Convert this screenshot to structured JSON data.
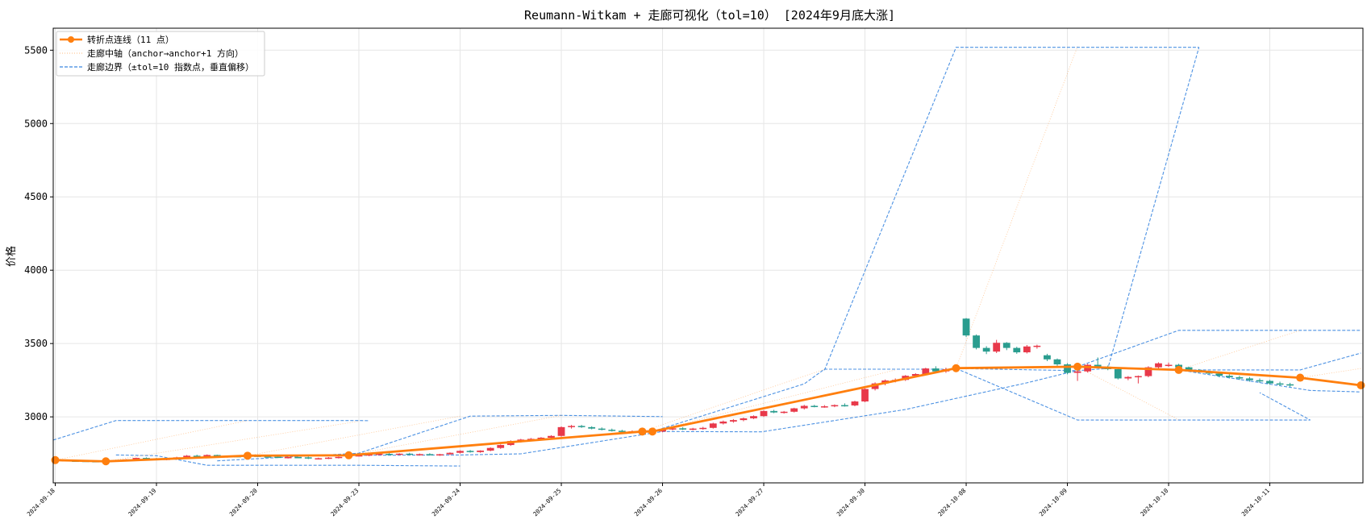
{
  "chart_data": {
    "type": "candlestick",
    "title": "Reumann-Witkam + 走廊可视化（tol=10）  [2024年9月底大涨]",
    "ylabel": "价格",
    "xlabel": "",
    "ylim": [
      2550,
      5650
    ],
    "yticks": [
      3000,
      3500,
      4000,
      4500,
      5000,
      5500
    ],
    "x_range": [
      -0.2,
      129.2
    ],
    "grid": true,
    "legend_position": "top-left",
    "xtick_labels": [
      {
        "i": 0,
        "label": "2024-09-18"
      },
      {
        "i": 10,
        "label": "2024-09-19"
      },
      {
        "i": 20,
        "label": "2024-09-20"
      },
      {
        "i": 30,
        "label": "2024-09-23"
      },
      {
        "i": 40,
        "label": "2024-09-24"
      },
      {
        "i": 50,
        "label": "2024-09-25"
      },
      {
        "i": 60,
        "label": "2024-09-26"
      },
      {
        "i": 70,
        "label": "2024-09-27"
      },
      {
        "i": 80,
        "label": "2024-09-30"
      },
      {
        "i": 90,
        "label": "2024-10-08"
      },
      {
        "i": 100,
        "label": "2024-10-09"
      },
      {
        "i": 110,
        "label": "2024-10-10"
      },
      {
        "i": 120,
        "label": "2024-10-11"
      }
    ],
    "colors": {
      "up": "#e8394a",
      "down": "#2a9d8f",
      "polyline": "#ff7f0e",
      "axis": "#ff7f0e",
      "band": "#3a86e0"
    },
    "legend": [
      {
        "label": "转折点连线（11 点）",
        "style": "polyline"
      },
      {
        "label": "走廊中轴（anchor→anchor+1 方向）",
        "style": "axis"
      },
      {
        "label": "走廊边界（±tol=10 指数点，垂直偏移）",
        "style": "band"
      }
    ],
    "candles_ohlc": [
      [
        2703,
        2708,
        2699,
        2704
      ],
      [
        2704,
        2709,
        2699,
        2702
      ],
      [
        2701,
        2706,
        2696,
        2700
      ],
      [
        2700,
        2705,
        2694,
        2698
      ],
      [
        2698,
        2703,
        2693,
        2697
      ],
      [
        2697,
        2704,
        2692,
        2699
      ],
      [
        2699,
        2706,
        2694,
        2702
      ],
      [
        2702,
        2712,
        2697,
        2710
      ],
      [
        2710,
        2722,
        2705,
        2720
      ],
      [
        2720,
        2724,
        2708,
        2712
      ],
      [
        2712,
        2720,
        2704,
        2710
      ],
      [
        2710,
        2718,
        2704,
        2714
      ],
      [
        2714,
        2728,
        2710,
        2724
      ],
      [
        2724,
        2740,
        2718,
        2735
      ],
      [
        2735,
        2742,
        2722,
        2728
      ],
      [
        2728,
        2744,
        2724,
        2740
      ],
      [
        2740,
        2742,
        2726,
        2728
      ],
      [
        2728,
        2736,
        2722,
        2732
      ],
      [
        2732,
        2738,
        2726,
        2730
      ],
      [
        2730,
        2738,
        2724,
        2735
      ],
      [
        2735,
        2740,
        2726,
        2730
      ],
      [
        2730,
        2736,
        2724,
        2728
      ],
      [
        2728,
        2733,
        2720,
        2722
      ],
      [
        2722,
        2730,
        2716,
        2726
      ],
      [
        2726,
        2732,
        2720,
        2724
      ],
      [
        2724,
        2730,
        2712,
        2716
      ],
      [
        2716,
        2722,
        2710,
        2718
      ],
      [
        2718,
        2726,
        2712,
        2722
      ],
      [
        2722,
        2730,
        2716,
        2727
      ],
      [
        2727,
        2738,
        2722,
        2735
      ],
      [
        2735,
        2742,
        2730,
        2738
      ],
      [
        2738,
        2748,
        2732,
        2744
      ],
      [
        2744,
        2752,
        2738,
        2748
      ],
      [
        2748,
        2756,
        2740,
        2745
      ],
      [
        2745,
        2752,
        2738,
        2749
      ],
      [
        2749,
        2755,
        2740,
        2742
      ],
      [
        2742,
        2750,
        2736,
        2746
      ],
      [
        2746,
        2752,
        2738,
        2740
      ],
      [
        2740,
        2748,
        2734,
        2745
      ],
      [
        2745,
        2758,
        2740,
        2755
      ],
      [
        2755,
        2772,
        2750,
        2768
      ],
      [
        2768,
        2774,
        2756,
        2760
      ],
      [
        2760,
        2772,
        2755,
        2770
      ],
      [
        2770,
        2792,
        2765,
        2788
      ],
      [
        2788,
        2812,
        2782,
        2808
      ],
      [
        2808,
        2840,
        2802,
        2835
      ],
      [
        2835,
        2850,
        2825,
        2845
      ],
      [
        2845,
        2856,
        2836,
        2850
      ],
      [
        2850,
        2862,
        2844,
        2858
      ],
      [
        2858,
        2875,
        2850,
        2870
      ],
      [
        2870,
        2935,
        2865,
        2930
      ],
      [
        2930,
        2945,
        2920,
        2938
      ],
      [
        2938,
        2945,
        2925,
        2930
      ],
      [
        2930,
        2936,
        2915,
        2920
      ],
      [
        2920,
        2928,
        2908,
        2912
      ],
      [
        2912,
        2920,
        2900,
        2905
      ],
      [
        2905,
        2912,
        2895,
        2900
      ],
      [
        2900,
        2908,
        2890,
        2902
      ],
      [
        2902,
        2908,
        2892,
        2896
      ],
      [
        2896,
        2905,
        2888,
        2900
      ],
      [
        2900,
        2920,
        2895,
        2915
      ],
      [
        2915,
        2928,
        2908,
        2922
      ],
      [
        2922,
        2930,
        2910,
        2914
      ],
      [
        2914,
        2925,
        2908,
        2920
      ],
      [
        2920,
        2932,
        2912,
        2925
      ],
      [
        2925,
        2960,
        2920,
        2955
      ],
      [
        2955,
        2975,
        2948,
        2968
      ],
      [
        2968,
        2985,
        2960,
        2978
      ],
      [
        2978,
        2995,
        2970,
        2990
      ],
      [
        2990,
        3010,
        2985,
        3005
      ],
      [
        3005,
        3045,
        3000,
        3040
      ],
      [
        3040,
        3048,
        3025,
        3030
      ],
      [
        3030,
        3040,
        3022,
        3035
      ],
      [
        3035,
        3062,
        3030,
        3058
      ],
      [
        3058,
        3082,
        3050,
        3075
      ],
      [
        3075,
        3082,
        3065,
        3070
      ],
      [
        3070,
        3080,
        3062,
        3072
      ],
      [
        3072,
        3085,
        3066,
        3080
      ],
      [
        3080,
        3092,
        3070,
        3078
      ],
      [
        3078,
        3110,
        3072,
        3105
      ],
      [
        3105,
        3195,
        3100,
        3190
      ],
      [
        3190,
        3235,
        3180,
        3228
      ],
      [
        3228,
        3255,
        3215,
        3248
      ],
      [
        3248,
        3262,
        3235,
        3252
      ],
      [
        3252,
        3285,
        3245,
        3280
      ],
      [
        3280,
        3298,
        3270,
        3292
      ],
      [
        3292,
        3335,
        3285,
        3330
      ],
      [
        3330,
        3345,
        3300,
        3310
      ],
      [
        3310,
        3335,
        3300,
        3325
      ],
      [
        3325,
        3348,
        3312,
        3336
      ],
      [
        3670,
        3674,
        3545,
        3555
      ],
      [
        3555,
        3562,
        3460,
        3470
      ],
      [
        3470,
        3482,
        3428,
        3445
      ],
      [
        3445,
        3525,
        3435,
        3505
      ],
      [
        3505,
        3510,
        3455,
        3470
      ],
      [
        3470,
        3478,
        3430,
        3440
      ],
      [
        3440,
        3490,
        3432,
        3480
      ],
      [
        3480,
        3492,
        3465,
        3485
      ],
      [
        3420,
        3430,
        3380,
        3392
      ],
      [
        3392,
        3398,
        3348,
        3358
      ],
      [
        3358,
        3366,
        3290,
        3300
      ],
      [
        3300,
        3315,
        3245,
        3310
      ],
      [
        3310,
        3362,
        3302,
        3355
      ],
      [
        3355,
        3405,
        3345,
        3342
      ],
      [
        3342,
        3350,
        3318,
        3325
      ],
      [
        3325,
        3330,
        3255,
        3262
      ],
      [
        3262,
        3278,
        3250,
        3272
      ],
      [
        3272,
        3282,
        3228,
        3278
      ],
      [
        3278,
        3345,
        3270,
        3338
      ],
      [
        3338,
        3372,
        3330,
        3365
      ],
      [
        3350,
        3370,
        3340,
        3355
      ],
      [
        3355,
        3362,
        3330,
        3338
      ],
      [
        3338,
        3342,
        3315,
        3320
      ],
      [
        3320,
        3326,
        3300,
        3305
      ],
      [
        3305,
        3312,
        3290,
        3295
      ],
      [
        3295,
        3302,
        3270,
        3280
      ],
      [
        3280,
        3290,
        3262,
        3270
      ],
      [
        3270,
        3280,
        3252,
        3262
      ],
      [
        3262,
        3272,
        3240,
        3250
      ],
      [
        3250,
        3262,
        3232,
        3245
      ],
      [
        3245,
        3252,
        3220,
        3228
      ],
      [
        3228,
        3240,
        3210,
        3222
      ],
      [
        3222,
        3232,
        3205,
        3215
      ]
    ],
    "turning_points": [
      {
        "x": 0,
        "y": 2705
      },
      {
        "x": 5,
        "y": 2697
      },
      {
        "x": 19,
        "y": 2735
      },
      {
        "x": 29,
        "y": 2738
      },
      {
        "x": 58,
        "y": 2900
      },
      {
        "x": 59,
        "y": 2900
      },
      {
        "x": 89,
        "y": 3332
      },
      {
        "x": 101,
        "y": 3342
      },
      {
        "x": 111,
        "y": 3320
      },
      {
        "x": 123,
        "y": 3267
      },
      {
        "x": 129,
        "y": 3215
      }
    ],
    "corridor_axes": [
      [
        [
          0,
          2705
        ],
        [
          19,
          2975
        ]
      ],
      [
        [
          5,
          2697
        ],
        [
          30,
          2970
        ]
      ],
      [
        [
          19,
          2735
        ],
        [
          40,
          3005
        ]
      ],
      [
        [
          29,
          2738
        ],
        [
          50,
          3010
        ]
      ],
      [
        [
          58,
          2900
        ],
        [
          76,
          3325
        ]
      ],
      [
        [
          59,
          2900
        ],
        [
          83,
          3320
        ]
      ],
      [
        [
          89,
          3332
        ],
        [
          101,
          5525
        ]
      ],
      [
        [
          101,
          3342
        ],
        [
          111,
          2980
        ]
      ],
      [
        [
          111,
          3320
        ],
        [
          123,
          3590
        ]
      ],
      [
        [
          123,
          3267
        ],
        [
          129,
          3330
        ]
      ]
    ],
    "corridor_bands": [
      {
        "upper": [
          [
            -0.2,
            2842
          ],
          [
            6,
            2975
          ],
          [
            19,
            2975
          ],
          [
            30,
            2975
          ],
          [
            31,
            2974
          ]
        ],
        "lower": [
          [
            6,
            2740
          ],
          [
            10,
            2735
          ],
          [
            15,
            2670
          ],
          [
            30,
            2670
          ],
          [
            40,
            2665
          ]
        ]
      },
      {
        "upper": [
          [
            16,
            2700
          ],
          [
            30,
            2752
          ],
          [
            41,
            3005
          ],
          [
            50,
            3010
          ],
          [
            60,
            3002
          ]
        ],
        "lower": [
          [
            30,
            2738
          ],
          [
            40,
            2740
          ],
          [
            46,
            2748
          ],
          [
            60,
            2900
          ],
          [
            70,
            2898
          ]
        ]
      },
      {
        "upper": [
          [
            59,
            2900
          ],
          [
            74,
            3225
          ],
          [
            76,
            3325
          ],
          [
            89,
            3325
          ]
        ],
        "lower": [
          [
            70,
            2900
          ],
          [
            84,
            3050
          ],
          [
            96,
            3232
          ],
          [
            100,
            3300
          ],
          [
            101,
            3315
          ]
        ]
      },
      {
        "upper": [
          [
            76,
            3318
          ],
          [
            89,
            5520
          ],
          [
            101,
            5520
          ],
          [
            113,
            5520
          ]
        ],
        "lower": [
          [
            89,
            3330
          ],
          [
            101,
            3315
          ],
          [
            104,
            3330
          ],
          [
            113,
            5520
          ]
        ]
      },
      {
        "upper": [
          [
            101,
            3342
          ],
          [
            111,
            3590
          ],
          [
            129,
            3590
          ]
        ],
        "lower": [
          [
            89,
            3330
          ],
          [
            101,
            2978
          ],
          [
            124,
            2978
          ],
          [
            119,
            3165
          ]
        ]
      },
      {
        "upper": [
          [
            111,
            3320
          ],
          [
            123,
            3320
          ],
          [
            129,
            3435
          ]
        ],
        "lower": [
          [
            111,
            3320
          ],
          [
            124,
            3180
          ],
          [
            129,
            3170
          ]
        ]
      }
    ]
  }
}
